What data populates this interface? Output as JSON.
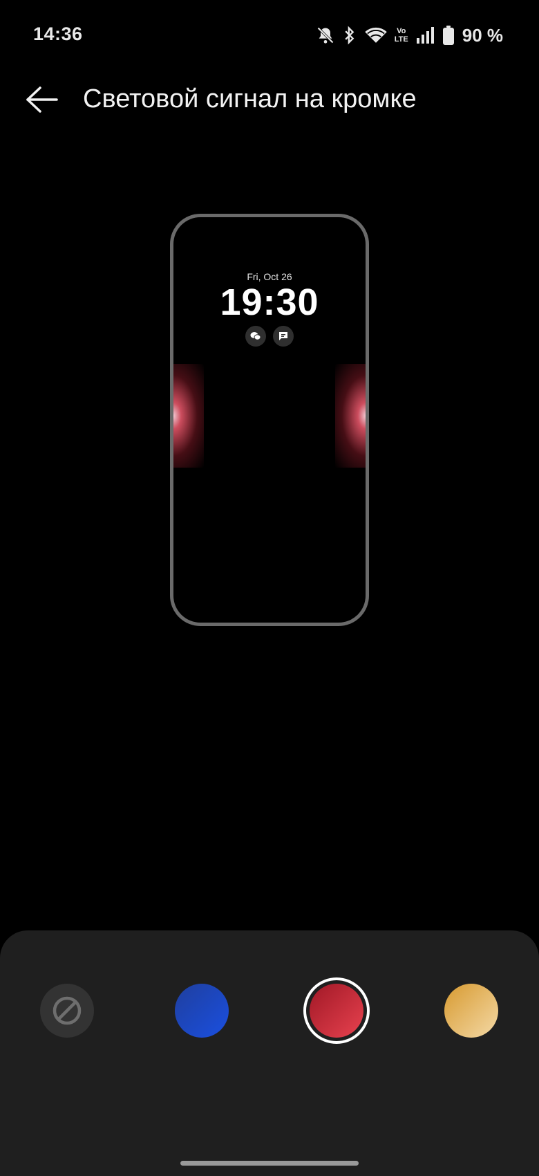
{
  "status_bar": {
    "time": "14:36",
    "battery_percent": "90 %",
    "network_label_top": "Vo",
    "network_label_bottom": "LTE",
    "icons": [
      "bell-muted-icon",
      "bluetooth-icon",
      "wifi-icon",
      "volte-icon",
      "signal-icon",
      "battery-icon"
    ]
  },
  "header": {
    "back_icon": "arrow-left-icon",
    "title": "Световой сигнал на кромке"
  },
  "preview": {
    "date": "Fri, Oct 26",
    "time": "19:30",
    "notification_icons": [
      "wechat-icon",
      "message-icon"
    ],
    "glow_color": "#e8424f"
  },
  "color_options": [
    {
      "name": "none",
      "icon": "disabled-icon",
      "selected": false
    },
    {
      "name": "blue",
      "color": "#1a4fe0",
      "selected": false
    },
    {
      "name": "red",
      "color": "#e8424f",
      "selected": true
    },
    {
      "name": "gold",
      "color": "#e8b566",
      "selected": false
    }
  ]
}
